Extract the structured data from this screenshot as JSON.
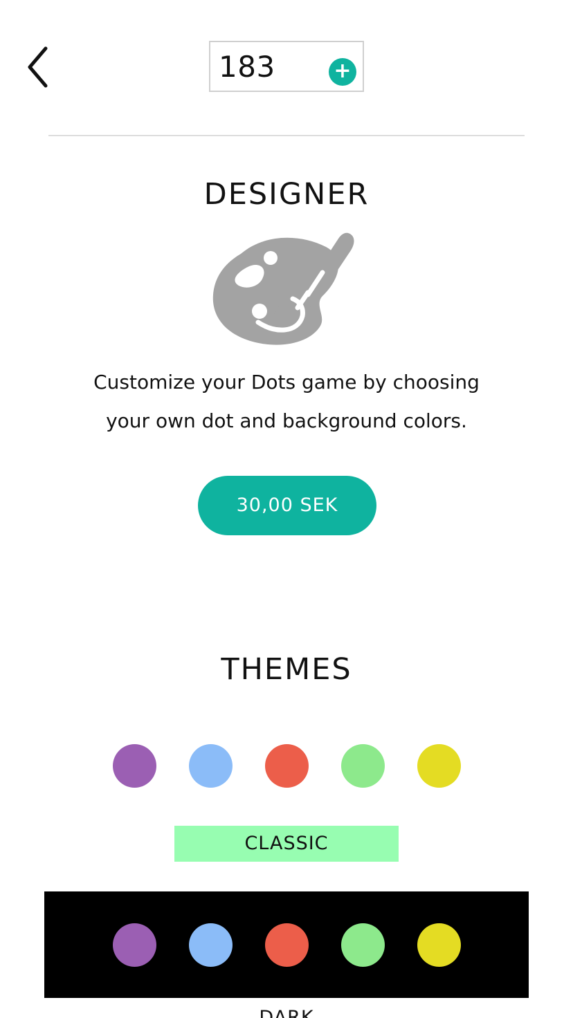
{
  "header": {
    "coin_count": "183",
    "add_label": "+"
  },
  "designer": {
    "title": "DESIGNER",
    "icon": "palette-brush-icon",
    "description_line1": "Customize your Dots game by choosing",
    "description_line2": "your own dot and background colors.",
    "price_label": "30,00 SEK"
  },
  "themes": {
    "title": "THEMES",
    "items": [
      {
        "label": "CLASSIC",
        "background": "#ffffff",
        "selected": true,
        "dot_colors": [
          "#9b5fb3",
          "#8bbcf8",
          "#ec5e4a",
          "#8de98c",
          "#e4dc23"
        ]
      },
      {
        "label": "DARK",
        "background": "#000000",
        "selected": false,
        "dot_colors": [
          "#9b5fb3",
          "#8bbcf8",
          "#ec5e4a",
          "#8de98c",
          "#e4dc23"
        ]
      }
    ]
  },
  "colors": {
    "accent": "#0fb39f",
    "selected_theme_highlight": "#97fdb1",
    "icon_gray": "#a3a3a3",
    "divider": "#dddddd"
  }
}
